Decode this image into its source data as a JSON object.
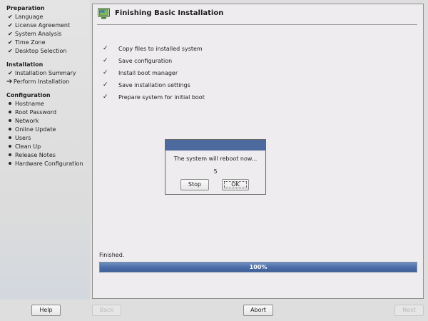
{
  "sidebar": {
    "preparation": {
      "title": "Preparation",
      "items": [
        {
          "label": "Language",
          "state": "done"
        },
        {
          "label": "License Agreement",
          "state": "done"
        },
        {
          "label": "System Analysis",
          "state": "done"
        },
        {
          "label": "Time Zone",
          "state": "done"
        },
        {
          "label": "Desktop Selection",
          "state": "done"
        }
      ]
    },
    "installation": {
      "title": "Installation",
      "items": [
        {
          "label": "Installation Summary",
          "state": "done"
        },
        {
          "label": "Perform Installation",
          "state": "current"
        }
      ]
    },
    "configuration": {
      "title": "Configuration",
      "items": [
        {
          "label": "Hostname",
          "state": "pending"
        },
        {
          "label": "Root Password",
          "state": "pending"
        },
        {
          "label": "Network",
          "state": "pending"
        },
        {
          "label": "Online Update",
          "state": "pending"
        },
        {
          "label": "Users",
          "state": "pending"
        },
        {
          "label": "Clean Up",
          "state": "pending"
        },
        {
          "label": "Release Notes",
          "state": "pending"
        },
        {
          "label": "Hardware Configuration",
          "state": "pending"
        }
      ]
    },
    "icons": {
      "done": "checkmark-icon",
      "current": "arrow-right-icon",
      "pending": "bullet-icon"
    }
  },
  "main": {
    "title": "Finishing Basic Installation",
    "title_icon": "installer-icon",
    "tasks": [
      "Copy files to installed system",
      "Save configuration",
      "Install boot manager",
      "Save installation settings",
      "Prepare system for initial boot"
    ],
    "status_text": "Finished.",
    "progress": {
      "value_percent": 100,
      "label": "100%"
    }
  },
  "dialog": {
    "message": "The system will reboot now...",
    "countdown": "5",
    "stop_label": "Stop",
    "ok_label": "OK"
  },
  "buttons": {
    "help": "Help",
    "back": "Back",
    "abort": "Abort",
    "next": "Next"
  },
  "colors": {
    "accent": "#4d6a9e",
    "progress_fill": "#4b6ea9",
    "panel_bg": "#efecef",
    "window_bg": "#dedede"
  }
}
